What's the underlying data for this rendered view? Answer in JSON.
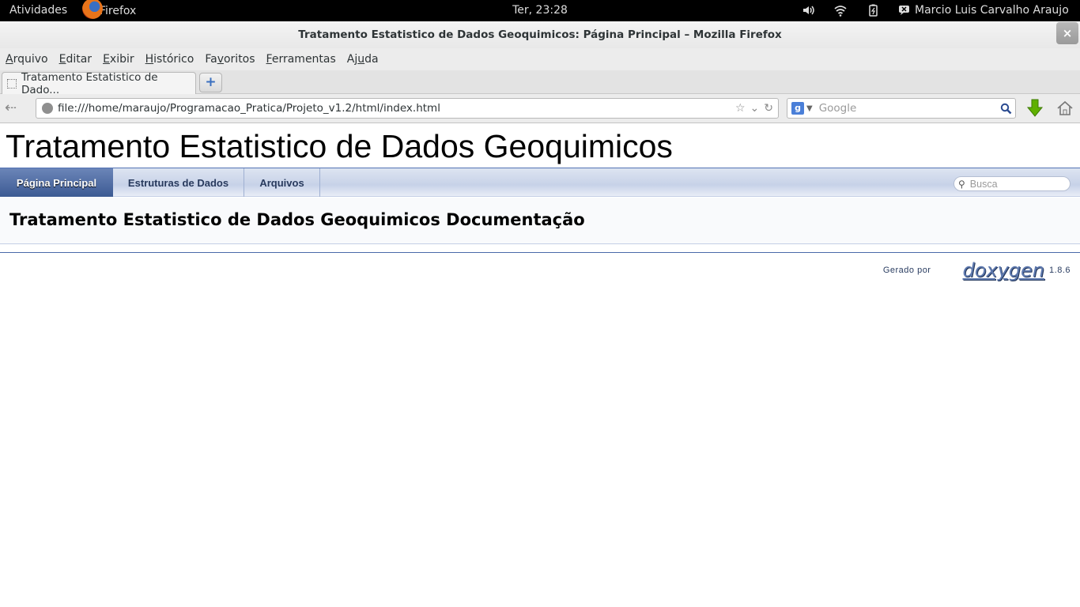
{
  "topbar": {
    "activities": "Atividades",
    "app_name": "Firefox",
    "clock": "Ter, 23:28",
    "user": "Marcio Luis Carvalho Araujo",
    "icons": [
      "volume-icon",
      "wifi-icon",
      "battery-icon",
      "chat-icon"
    ]
  },
  "window": {
    "title": "Tratamento Estatistico de Dados Geoquimicos: Página Principal – Mozilla Firefox",
    "close": "×"
  },
  "menubar": {
    "items": [
      {
        "mnemonic": "A",
        "rest": "rquivo"
      },
      {
        "mnemonic": "E",
        "rest": "ditar"
      },
      {
        "mnemonic": "E",
        "rest": "xibir"
      },
      {
        "mnemonic": "H",
        "rest": "istórico"
      },
      {
        "pre": "Fa",
        "mnemonic": "v",
        "rest": "oritos"
      },
      {
        "mnemonic": "F",
        "rest": "erramentas"
      },
      {
        "pre": "Aj",
        "mnemonic": "u",
        "rest": "da"
      }
    ]
  },
  "tab": {
    "label": "Tratamento Estatistico de Dado...",
    "new_tab": "+"
  },
  "nav": {
    "url": "file:///home/maraujo/Programacao_Pratica/Projeto_v1.2/html/index.html",
    "search_engine": "g",
    "search_placeholder": "Google"
  },
  "page": {
    "project_name": "Tratamento Estatistico de Dados Geoquimicos",
    "tabs": [
      {
        "label": "Página Principal",
        "active": true
      },
      {
        "label": "Estruturas de Dados",
        "active": false
      },
      {
        "label": "Arquivos",
        "active": false
      }
    ],
    "search_placeholder": "Busca",
    "header_title": "Tratamento Estatistico de Dados Geoquimicos Documentação",
    "footer_prefix": "Gerado por",
    "footer_logo": "doxygen",
    "footer_version": "1.8.6"
  },
  "colors": {
    "nav_active": "#3c5a93",
    "footer_logo": "#5e79ae",
    "download_arrow": "#5fb000"
  }
}
